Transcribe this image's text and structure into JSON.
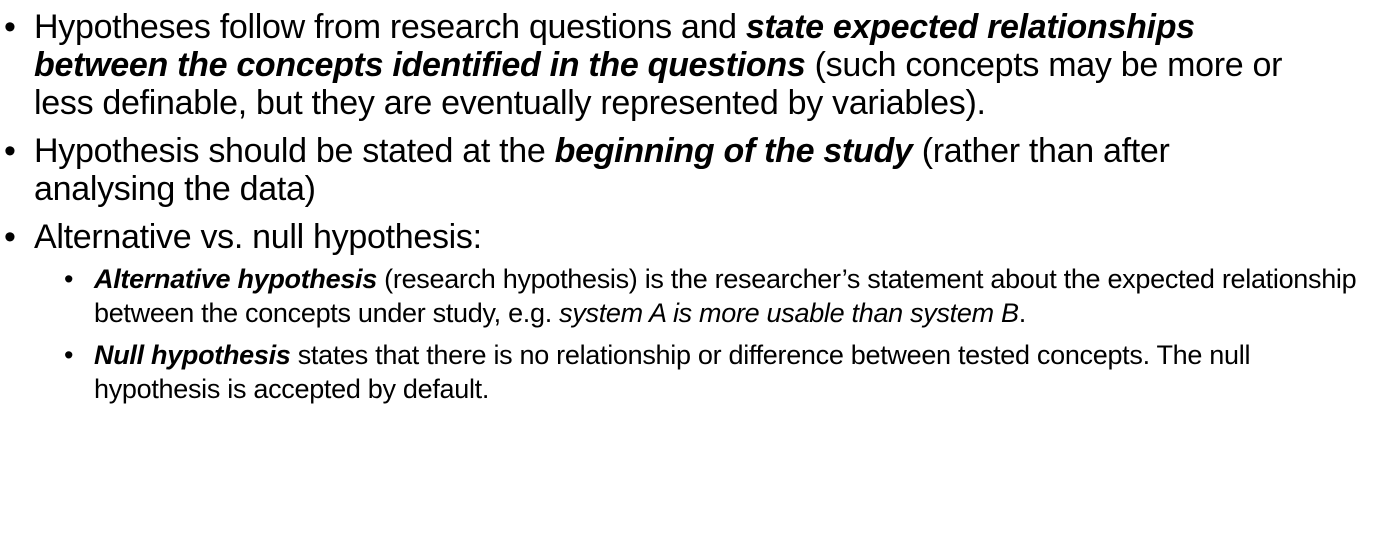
{
  "bullets": [
    {
      "pre": "Hypotheses follow from research questions and ",
      "emph": "state expected relationships between the concepts identified in the questions",
      "post": " (such concepts may be more or less definable, but they are eventually represented by variables)."
    },
    {
      "pre": "Hypothesis should be stated at the ",
      "emph": "beginning of the study",
      "post": " (rather than after analysing the data)"
    },
    {
      "text": "Alternative vs. null hypothesis:",
      "sub": [
        {
          "emph": "Alternative hypothesis",
          "mid": " (research hypothesis) is the researcher’s statement about the expected relationship between the concepts under study, e.g. ",
          "italic": "system A is more usable than system B",
          "post": "."
        },
        {
          "emph": "Null hypothesis",
          "mid": " states that there is no relationship or difference between tested concepts. The null hypothesis is accepted by default."
        }
      ]
    }
  ]
}
